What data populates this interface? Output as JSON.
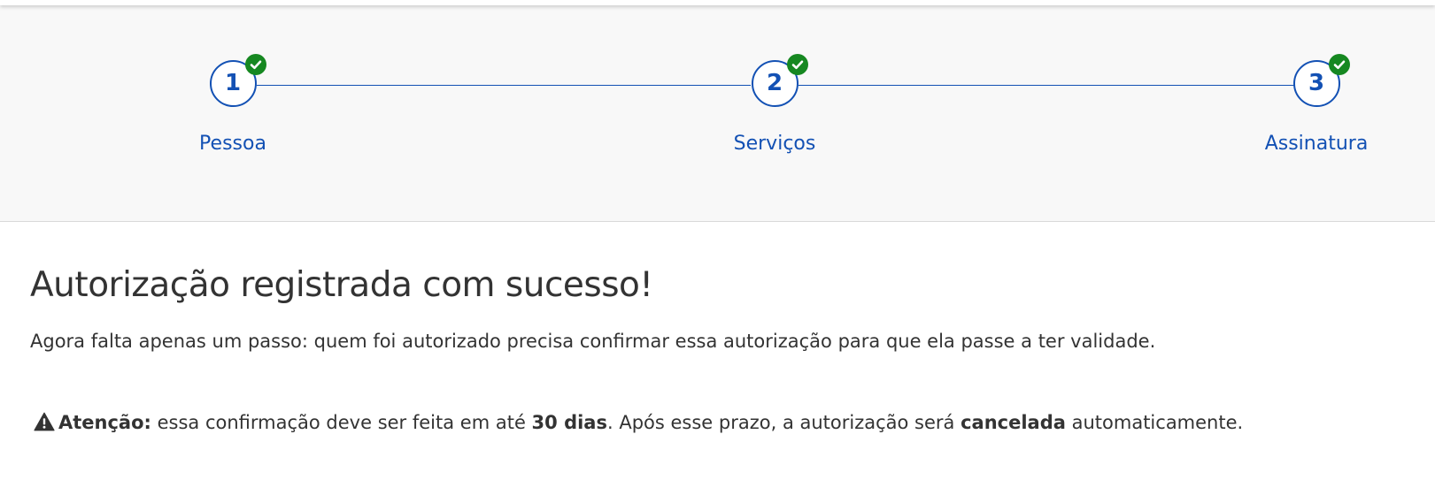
{
  "stepper": {
    "steps": [
      {
        "number": "1",
        "label": "Pessoa",
        "completed": true
      },
      {
        "number": "2",
        "label": "Serviços",
        "completed": true
      },
      {
        "number": "3",
        "label": "Assinatura",
        "completed": true
      }
    ],
    "icon": "check-icon"
  },
  "main": {
    "title": "Autorização registrada com sucesso!",
    "subtitle": "Agora falta apenas um passo: quem foi autorizado precisa confirmar essa autorização para que ela passe a ter validade.",
    "warning": {
      "icon": "warning-triangle-icon",
      "label": "Atenção:",
      "text_1": " essa confirmação deve ser feita em até ",
      "deadline": "30 dias",
      "text_2": ". Após esse prazo, a autorização será ",
      "emphasis": "cancelada",
      "text_3": " automaticamente."
    }
  },
  "colors": {
    "primary": "#1351b4",
    "success": "#168821",
    "text": "#333333",
    "stepper_bg": "#f8f8f8"
  }
}
